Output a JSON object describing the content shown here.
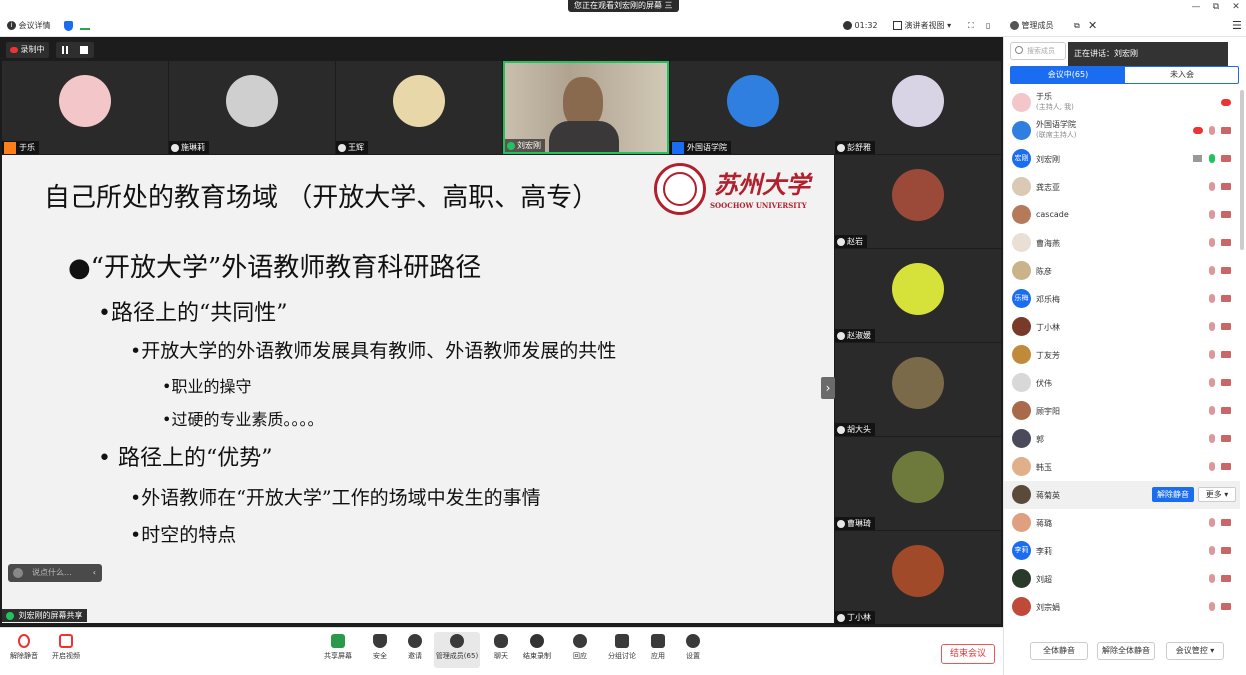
{
  "window": {
    "share_banner": "您正在观看刘宏刚的屏幕",
    "share_banner_menu": "三",
    "controls": [
      "—",
      "⧉",
      "✕"
    ]
  },
  "toolbar": {
    "meeting_info": "会议详情",
    "timer": "01:32",
    "view_mode": "演讲者视图",
    "manage_members": "管理成员"
  },
  "recording": {
    "label": "录制中"
  },
  "tiles": [
    {
      "name": "于乐",
      "avatar_color": "#f3c6c9",
      "tag": "host"
    },
    {
      "name": "施琳莉",
      "avatar_color": "#cfcfcf",
      "tag": "mic"
    },
    {
      "name": "王辉",
      "avatar_color": "#e8d7a8",
      "tag": "mic"
    },
    {
      "name": "刘宏刚",
      "avatar_color": "#8a7a66",
      "tag": "mic"
    },
    {
      "name": "外国语学院",
      "avatar_color": "#2f7fe0",
      "tag": "cohost"
    }
  ],
  "right_tiles": [
    {
      "name": "彭舒雅",
      "avatar_color": "#d9d3e6"
    },
    {
      "name": "赵岩",
      "avatar_color": "#9b4a3a"
    },
    {
      "name": "赵淑媛",
      "avatar_color": "#d6e23a"
    },
    {
      "name": "胡大头",
      "avatar_color": "#7a6a4a"
    },
    {
      "name": "曹琳琦",
      "avatar_color": "#6d7a3c"
    },
    {
      "name": "丁小林",
      "avatar_color": "#a04a2a"
    }
  ],
  "slide": {
    "title": "自己所处的教育场域 （开放大学、高职、高专）",
    "logo_cn": "苏州大学",
    "logo_en": "SOOCHOW UNIVERSITY",
    "bullets": [
      {
        "level": 1,
        "text": "●“开放大学”外语教师教育科研路径"
      },
      {
        "level": 2,
        "text": "•路径上的“共同性”"
      },
      {
        "level": 3,
        "text": "•开放大学的外语教师发展具有教师、外语教师发展的共性"
      },
      {
        "level": 4,
        "text": "•职业的操守"
      },
      {
        "level": 4,
        "text": "•过硬的专业素质。。。。"
      },
      {
        "level": 2,
        "text": "• 路径上的“优势”"
      },
      {
        "level": 3,
        "text": "•外语教师在“开放大学”工作的场域中发生的事情"
      },
      {
        "level": 3,
        "text": "•时空的特点"
      }
    ]
  },
  "chat": {
    "placeholder": "说点什么..."
  },
  "sharer_label": "刘宏刚的屏幕共享",
  "bottom_bar": [
    {
      "label": "解除静音",
      "name": "unmute-button",
      "icon": "mic-muted-icon"
    },
    {
      "label": "开启视频",
      "name": "start-video-button",
      "icon": "camera-off-icon"
    },
    {
      "label": "共享屏幕",
      "name": "share-screen-button",
      "icon": "share-screen-icon"
    },
    {
      "label": "安全",
      "name": "security-button",
      "icon": "shield-icon"
    },
    {
      "label": "邀请",
      "name": "invite-button",
      "icon": "add-user-icon"
    },
    {
      "label": "管理成员(65)",
      "name": "manage-members-button",
      "icon": "members-icon"
    },
    {
      "label": "聊天",
      "name": "chat-button",
      "icon": "chat-icon"
    },
    {
      "label": "结束录制",
      "name": "stop-recording-button",
      "icon": "record-icon"
    },
    {
      "label": "回应",
      "name": "reaction-button",
      "icon": "reaction-icon"
    },
    {
      "label": "分组讨论",
      "name": "breakout-button",
      "icon": "breakout-icon"
    },
    {
      "label": "应用",
      "name": "apps-button",
      "icon": "apps-icon"
    },
    {
      "label": "设置",
      "name": "settings-button",
      "icon": "gear-icon"
    }
  ],
  "end_meeting": "结束会议",
  "sidebar": {
    "search_placeholder": "搜索成员",
    "speaking": "正在讲话：刘宏刚",
    "tabs": [
      "会议中(65)",
      "未入会"
    ],
    "participants": [
      {
        "name": "于乐",
        "sub": "(主持人, 我)",
        "avatar_color": "#f3c6c9"
      },
      {
        "name": "外国语学院",
        "sub": "(联席主持人)",
        "avatar_color": "#2f7fe0"
      },
      {
        "name": "刘宏刚",
        "avatar_color": "#1a6cf0",
        "avatar_text": "宏刚"
      },
      {
        "name": "龚志亚",
        "avatar_color": "#d9c9b5"
      },
      {
        "name": "cascade",
        "avatar_color": "#b57a5a"
      },
      {
        "name": "曹海燕",
        "avatar_color": "#e9dfd4"
      },
      {
        "name": "陈彦",
        "avatar_color": "#c9b48a"
      },
      {
        "name": "邓乐梅",
        "avatar_color": "#1a6cf0",
        "avatar_text": "乐梅"
      },
      {
        "name": "丁小林",
        "avatar_color": "#7a3a2a"
      },
      {
        "name": "丁友芳",
        "avatar_color": "#c08a3a"
      },
      {
        "name": "伏伟",
        "avatar_color": "#d8d8d8"
      },
      {
        "name": "顾宇阳",
        "avatar_color": "#a86a4a"
      },
      {
        "name": "郭",
        "avatar_color": "#4a4a5a"
      },
      {
        "name": "韩玉",
        "avatar_color": "#e0b08a"
      },
      {
        "name": "蒋菊英",
        "avatar_color": "#5a4a3a"
      },
      {
        "name": "蒋璐",
        "avatar_color": "#e0a080"
      },
      {
        "name": "李莉",
        "avatar_color": "#1a6cf0",
        "avatar_text": "李莉"
      },
      {
        "name": "刘超",
        "avatar_color": "#2a3a2a"
      },
      {
        "name": "刘宗娟",
        "avatar_color": "#c04a3a"
      }
    ],
    "unmute_label": "解除静音",
    "more_label": "更多 ▾",
    "mute_all": "全体静音",
    "unmute_all": "解除全体静音",
    "meeting_control": "会议管控 ▾"
  }
}
